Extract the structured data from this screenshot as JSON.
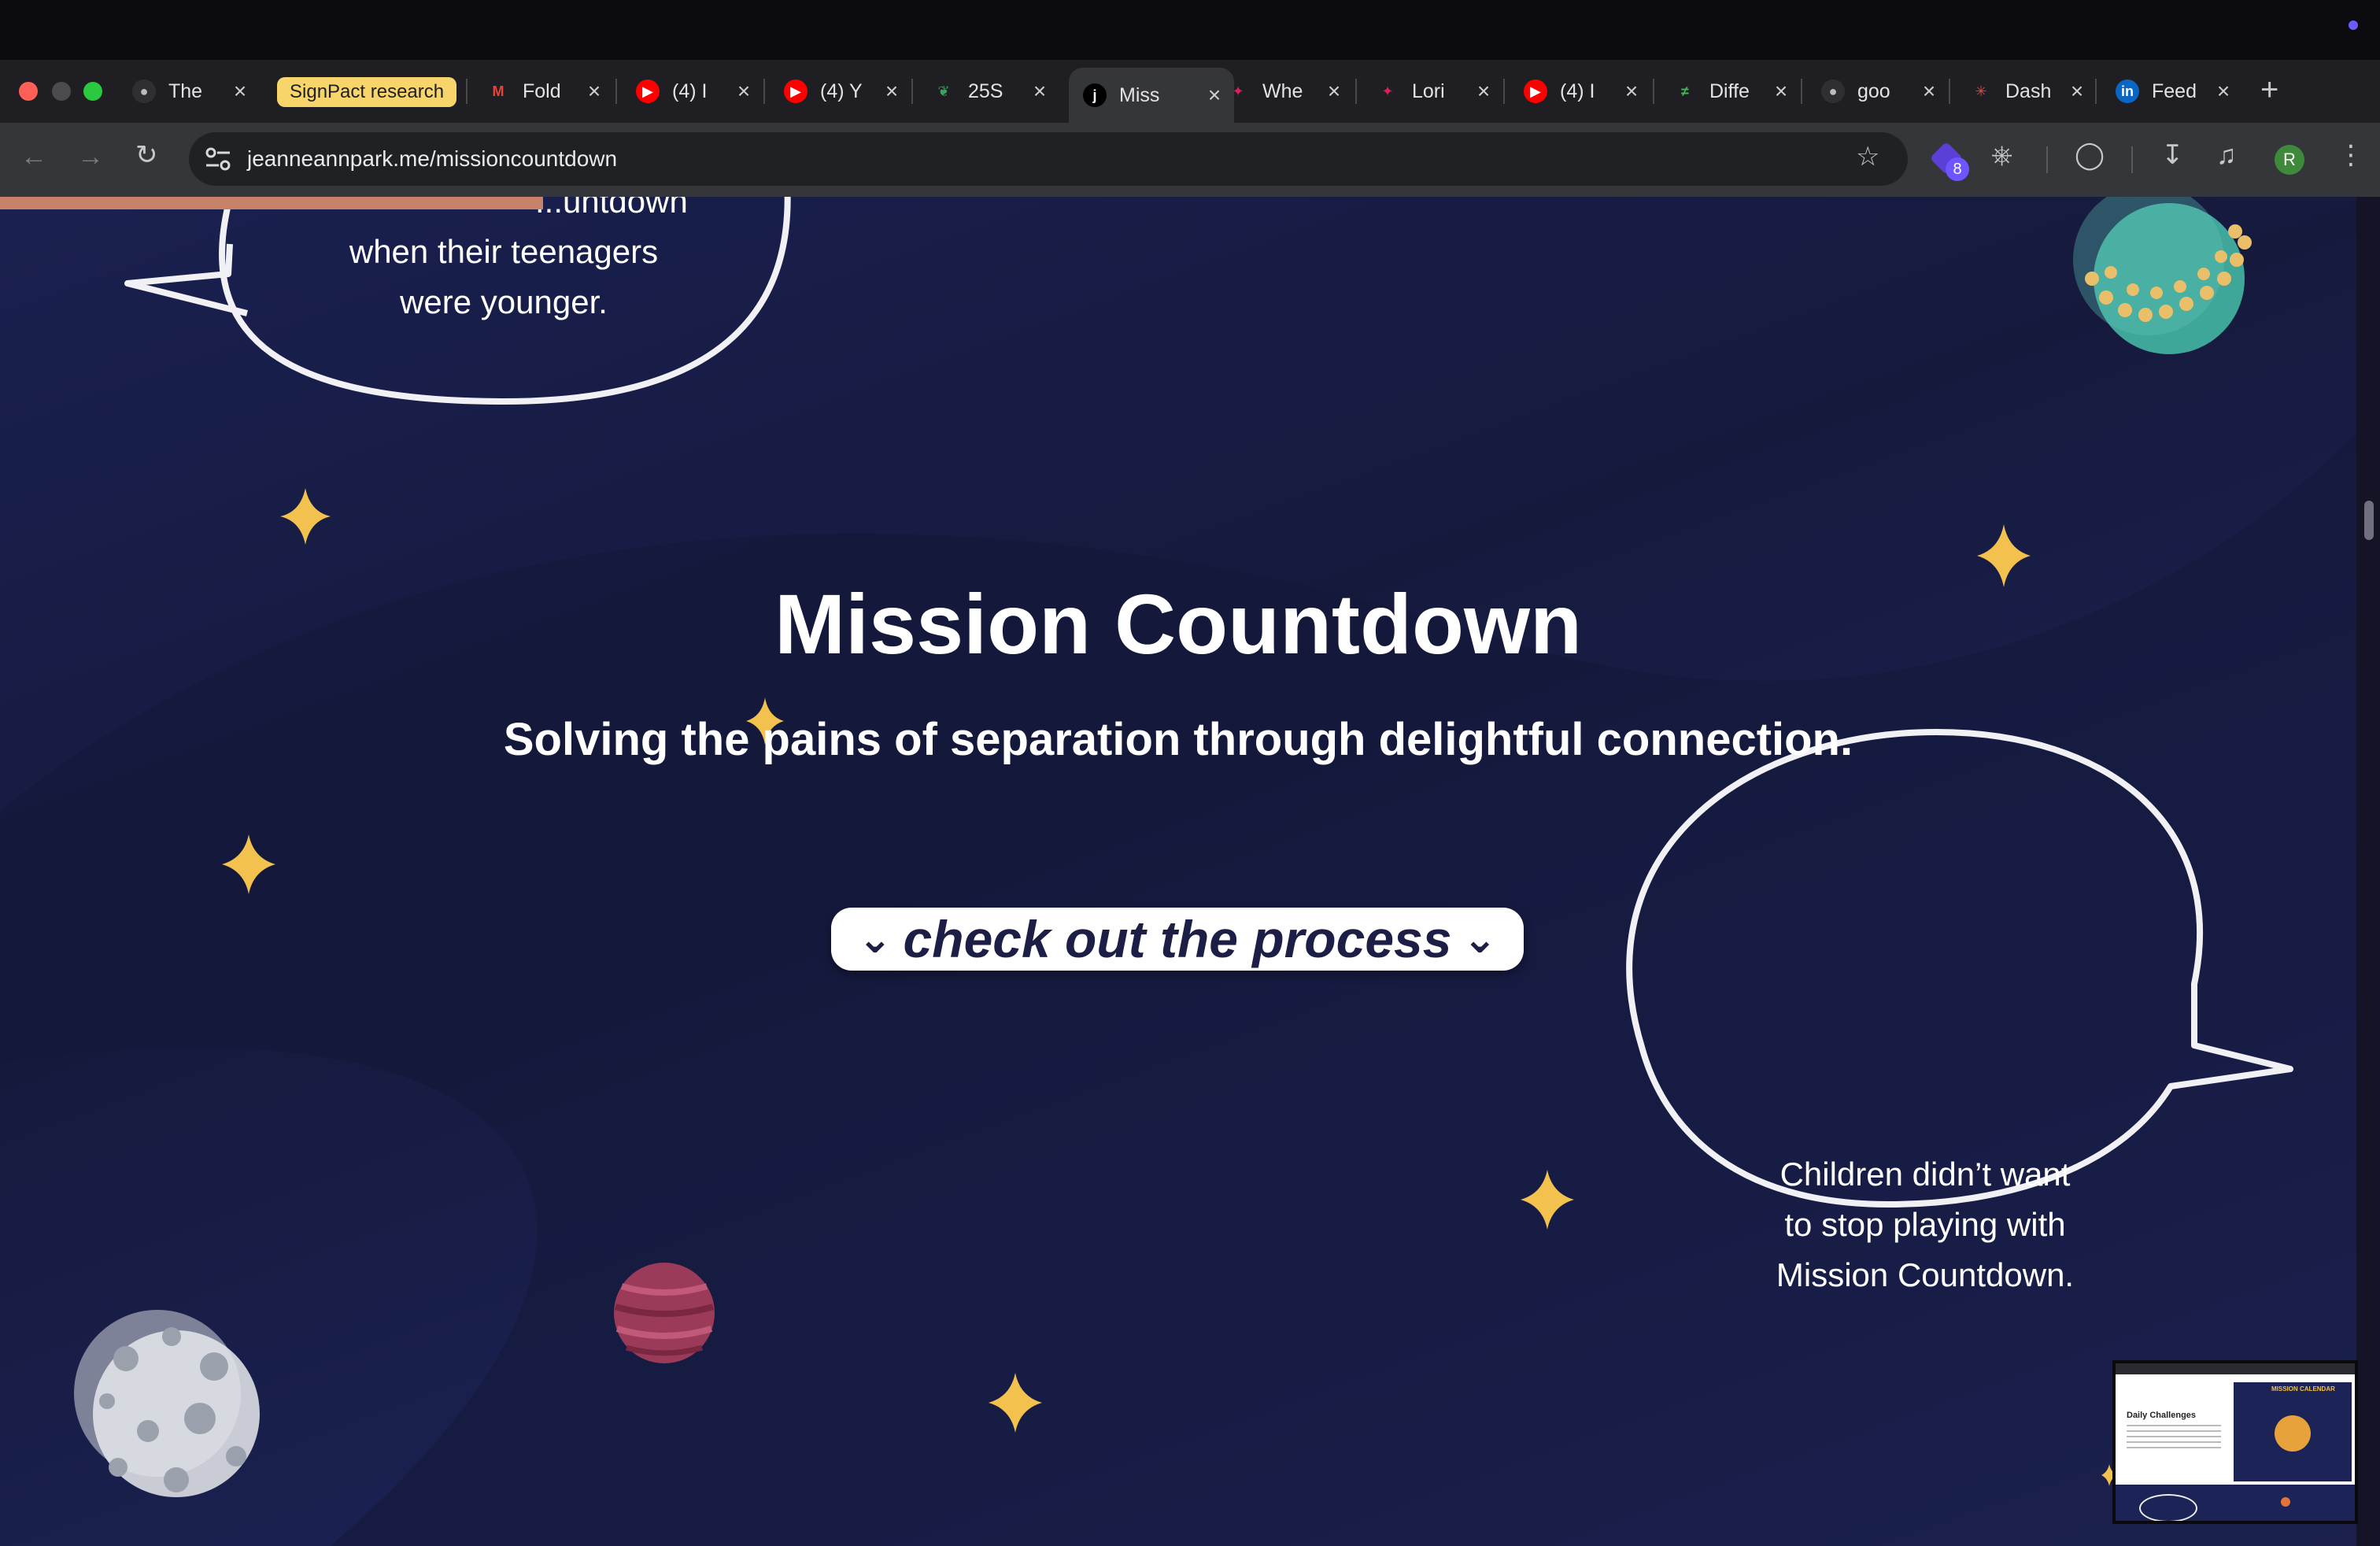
{
  "tabs": [
    {
      "title": "The",
      "icon": "globe-icon"
    },
    {
      "title": "Fold",
      "icon": "gmail-icon"
    },
    {
      "title": "(4) I",
      "icon": "youtube-icon"
    },
    {
      "title": "(4) Y",
      "icon": "youtube-icon"
    },
    {
      "title": "25S",
      "icon": "leaf-icon"
    },
    {
      "title": "Miss",
      "icon": "j-logo-icon",
      "active": true
    },
    {
      "title": "Whe",
      "icon": "slack-icon"
    },
    {
      "title": "Lori",
      "icon": "slack-icon"
    },
    {
      "title": "(4) I",
      "icon": "youtube-icon"
    },
    {
      "title": "Diffe",
      "icon": "diff-icon"
    },
    {
      "title": "goo",
      "icon": "globe-icon"
    },
    {
      "title": "Dash",
      "icon": "dashboard-icon"
    },
    {
      "title": "Feed",
      "icon": "linkedin-icon"
    }
  ],
  "tab_group": "SignPact research",
  "address_bar": {
    "url": "jeanneannpark.me/missioncountdown"
  },
  "profile_initial": "R",
  "extensions_badge": "8",
  "page": {
    "bubble_top": {
      "line1": "...untdown",
      "line2": "when their teenagers",
      "line3": "were younger."
    },
    "title": "Mission Countdown",
    "subtitle": "Solving the pains of separation through delightful connection.",
    "cta": "check out the process",
    "bubble_right": {
      "line1": "Children didn’t want",
      "line2": "to stop playing with",
      "line3": "Mission Countdown."
    },
    "thumbnail": {
      "heading": "Daily Challenges",
      "calendar_label": "MISSION CALENDAR"
    }
  },
  "colors": {
    "background_start": "#1a2050",
    "background_end": "#242b68",
    "star": "#f2c14e",
    "cta_text": "#1c1e45",
    "reading_progress": "#c9826a"
  }
}
